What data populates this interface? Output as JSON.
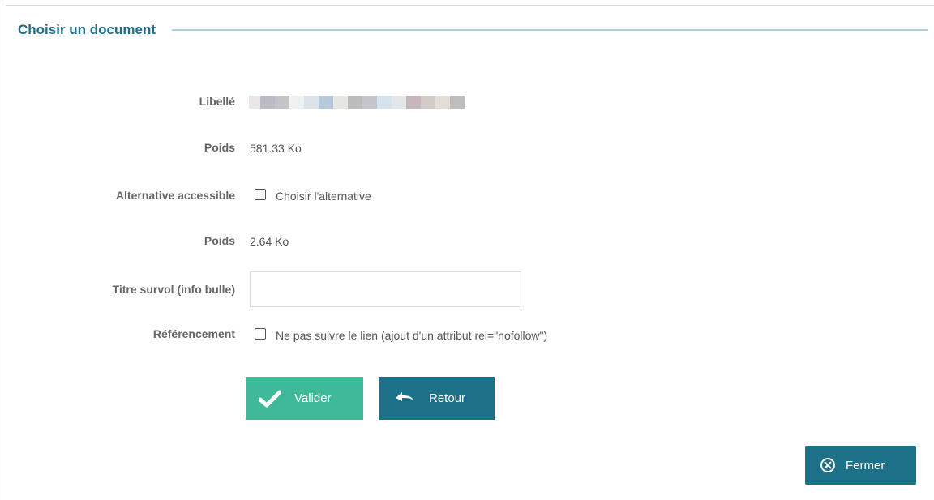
{
  "dialog": {
    "title": "Choisir un document"
  },
  "form": {
    "libelle_label": "Libellé",
    "poids_label_1": "Poids",
    "poids_value_1": "581.33 Ko",
    "alternative_label": "Alternative accessible",
    "alternative_checkbox_label": "Choisir l'alternative",
    "poids_label_2": "Poids",
    "poids_value_2": "2.64 Ko",
    "titre_survol_label": "Titre survol (info bulle)",
    "titre_survol_value": "",
    "referencement_label": "Référencement",
    "referencement_checkbox_label": "Ne pas suivre le lien (ajout d'un attribut rel=\"nofollow\")"
  },
  "buttons": {
    "valider": "Valider",
    "retour": "Retour",
    "fermer": "Fermer"
  },
  "colors": {
    "title": "#1f6e87",
    "valider_bg": "#3fba99",
    "retour_bg": "#1c7087",
    "fermer_bg": "#1c7087"
  }
}
